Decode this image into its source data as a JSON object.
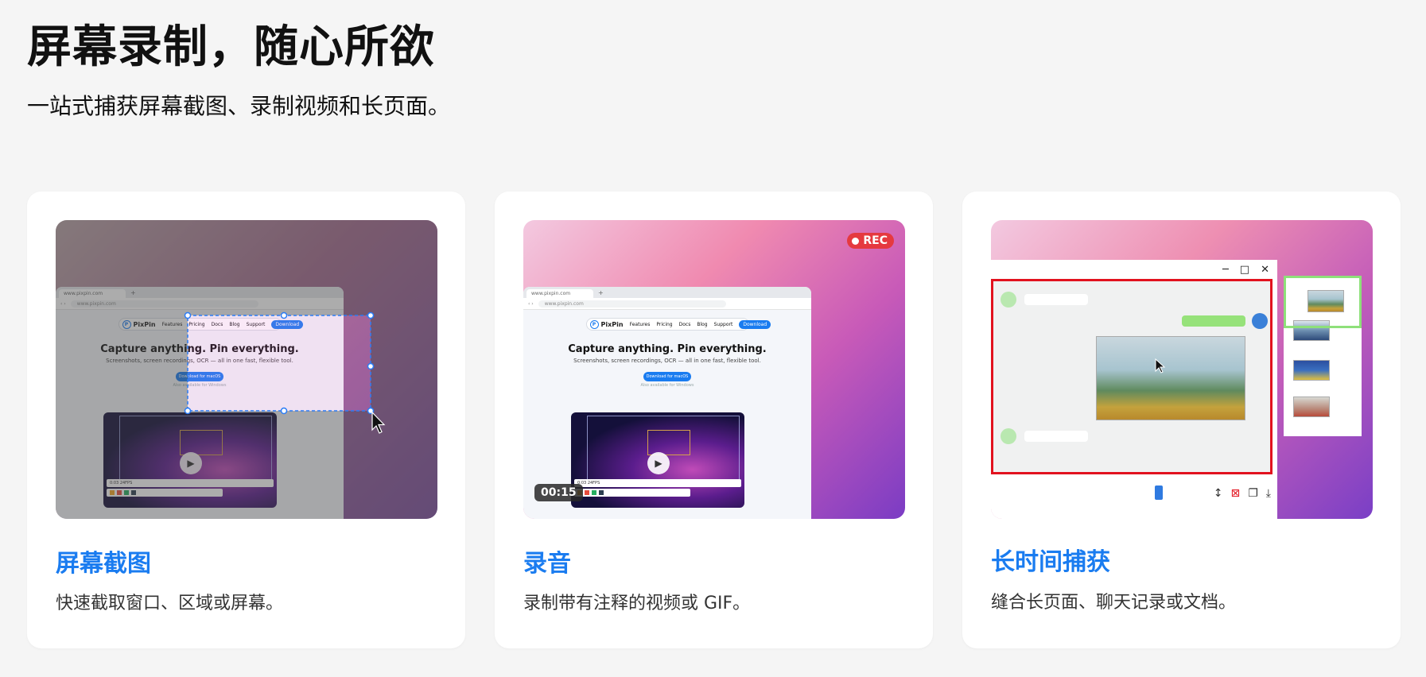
{
  "hero": {
    "title": "屏幕录制，随心所欲",
    "subtitle": "一站式捕获屏幕截图、录制视频和长页面。"
  },
  "cards": [
    {
      "title": "屏幕截图",
      "description": "快速截取窗口、区域或屏幕。"
    },
    {
      "title": "录音",
      "description": "录制带有注释的视频或 GIF。"
    },
    {
      "title": "长时间捕获",
      "description": "缝合长页面、聊天记录或文档。"
    }
  ],
  "mockup": {
    "url": "www.pixpin.com",
    "brand": "PixPin",
    "nav": [
      "Features",
      "Pricing",
      "Docs",
      "Blog",
      "Support"
    ],
    "nav_cta": "Download",
    "headline": "Capture anything. Pin everything.",
    "tagline": "Screenshots, screen recordings, OCR — all in one fast, flexible tool.",
    "cta": "Download for macOS",
    "note": "Also available for Windows",
    "video_toolbar": "0:03 24FPS"
  },
  "recording": {
    "badge": "REC",
    "timer": "00:15"
  },
  "long_capture": {
    "window_controls": [
      "─",
      "□",
      "✕"
    ]
  },
  "colors": {
    "accent": "#1a7cf0",
    "rec": "#e5393f",
    "capture_frame": "#e2121e",
    "highlight": "#8ee07a"
  },
  "icons": [
    "cursor-icon",
    "play-icon",
    "rec-dot-icon",
    "minimize-icon",
    "maximize-icon",
    "close-icon",
    "resize-vertical-icon",
    "delete-icon",
    "copy-icon",
    "download-icon"
  ]
}
